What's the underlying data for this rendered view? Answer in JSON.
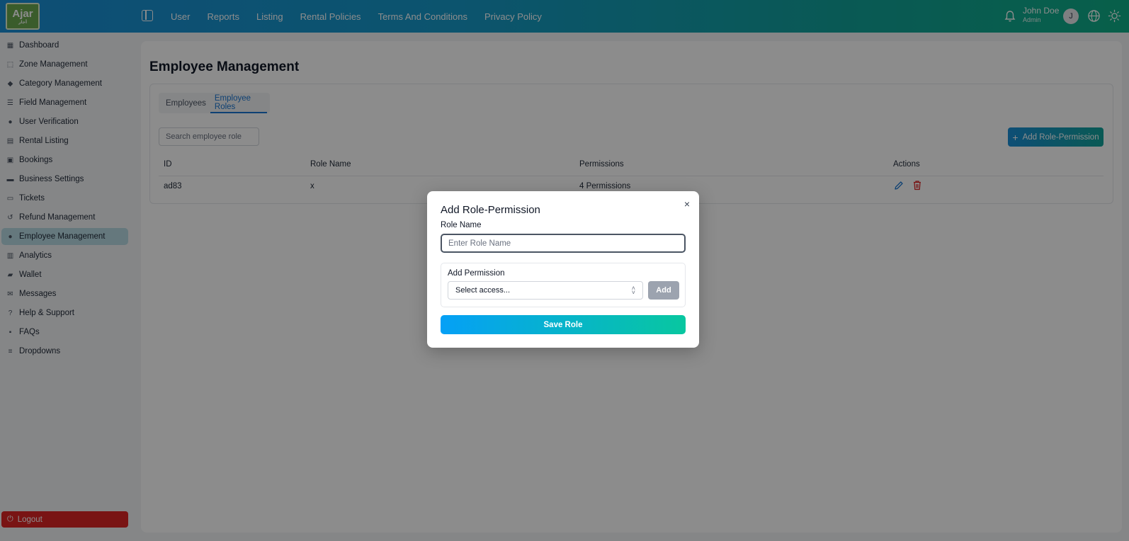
{
  "app": {
    "logo_text": "Ajar",
    "logo_sub": "أجار"
  },
  "topnav": [
    "User",
    "Reports",
    "Listing",
    "Rental Policies",
    "Terms And Conditions",
    "Privacy Policy"
  ],
  "user": {
    "name": "John Doe",
    "role": "Admin",
    "initial": "J"
  },
  "sidebar": {
    "items": [
      {
        "label": "Dashboard",
        "icon": "dashboard-icon"
      },
      {
        "label": "Zone Management",
        "icon": "zone-icon"
      },
      {
        "label": "Category Management",
        "icon": "category-icon"
      },
      {
        "label": "Field Management",
        "icon": "sliders-icon"
      },
      {
        "label": "User Verification",
        "icon": "users-icon"
      },
      {
        "label": "Rental Listing",
        "icon": "clipboard-icon"
      },
      {
        "label": "Bookings",
        "icon": "calendar-icon"
      },
      {
        "label": "Business Settings",
        "icon": "settings-card-icon"
      },
      {
        "label": "Tickets",
        "icon": "ticket-icon"
      },
      {
        "label": "Refund Management",
        "icon": "refund-icon"
      },
      {
        "label": "Employee Management",
        "icon": "employees-icon",
        "active": true
      },
      {
        "label": "Analytics",
        "icon": "chart-icon"
      },
      {
        "label": "Wallet",
        "icon": "wallet-icon"
      },
      {
        "label": "Messages",
        "icon": "mail-icon"
      },
      {
        "label": "Help & Support",
        "icon": "question-icon"
      },
      {
        "label": "FAQs",
        "icon": "faq-icon"
      },
      {
        "label": "Dropdowns",
        "icon": "list-icon"
      }
    ],
    "logout": "Logout"
  },
  "page": {
    "title": "Employee Management",
    "tabs": [
      {
        "label": "Employees",
        "active": false
      },
      {
        "label": "Employee Roles",
        "active": true
      }
    ],
    "search_placeholder": "Search employee role",
    "add_button": "Add Role-Permission",
    "table": {
      "headers": [
        "ID",
        "Role Name",
        "Permissions",
        "Actions"
      ],
      "rows": [
        {
          "id": "ad83",
          "role_name": "x",
          "permissions": "4 Permissions"
        }
      ]
    }
  },
  "modal": {
    "title": "Add Role-Permission",
    "close": "×",
    "role_label": "Role Name",
    "role_placeholder": "Enter Role Name",
    "permission_label": "Add Permission",
    "select_value": "Select access...",
    "add_label": "Add",
    "save_label": "Save Role"
  },
  "colors": {
    "accent_blue": "#1976d2",
    "danger": "#dc2626",
    "gradient_start": "#1a8fd6",
    "gradient_end": "#0fae87"
  }
}
